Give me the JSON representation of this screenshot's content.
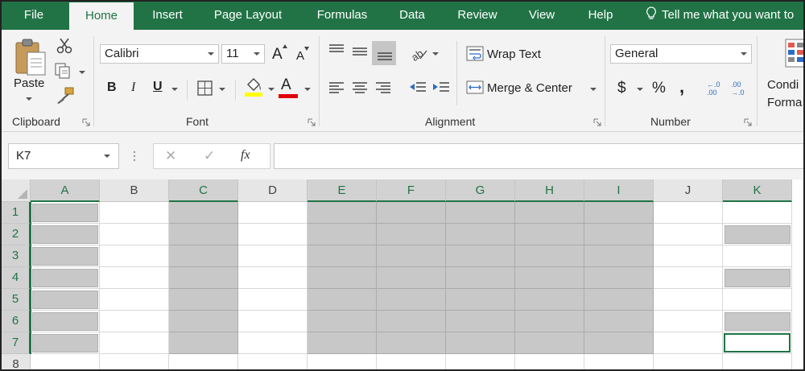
{
  "tabs": [
    "File",
    "Home",
    "Insert",
    "Page Layout",
    "Formulas",
    "Data",
    "Review",
    "View",
    "Help"
  ],
  "active_tab": "Home",
  "tell_me": "Tell me what you want to",
  "clipboard": {
    "paste_label": "Paste",
    "group_label": "Clipboard"
  },
  "font": {
    "name": "Calibri",
    "size": "11",
    "group_label": "Font",
    "bold": "B",
    "italic": "I",
    "underline": "U",
    "grow": "A",
    "shrink": "A",
    "font_color_letter": "A"
  },
  "alignment": {
    "wrap_text": "Wrap Text",
    "merge_center": "Merge & Center",
    "group_label": "Alignment"
  },
  "number": {
    "format": "General",
    "currency": "$",
    "percent": "%",
    "comma": ",",
    "inc_decimal": "←.0 .00",
    "dec_decimal": ".00 →.0",
    "group_label": "Number"
  },
  "styles": {
    "cond_format_line1": "Condi",
    "cond_format_line2": "Forma"
  },
  "formula_bar": {
    "name_box": "K7",
    "cancel": "✕",
    "enter": "✓",
    "fx": "fx",
    "formula": ""
  },
  "columns": [
    "A",
    "B",
    "C",
    "D",
    "E",
    "F",
    "G",
    "H",
    "I",
    "J",
    "K"
  ],
  "rows": [
    "1",
    "2",
    "3",
    "4",
    "5",
    "6",
    "7",
    "8"
  ],
  "selected_columns": [
    "A",
    "C",
    "E",
    "F",
    "G",
    "H",
    "I",
    "K"
  ],
  "selected_rows": [
    "1",
    "2",
    "3",
    "4",
    "5",
    "6",
    "7"
  ],
  "active_cell": "K7",
  "colors": {
    "accent": "#217346",
    "selection_fill": "#c8c8c8",
    "highlight_yellow": "#ffff00",
    "font_red": "#e00000"
  }
}
